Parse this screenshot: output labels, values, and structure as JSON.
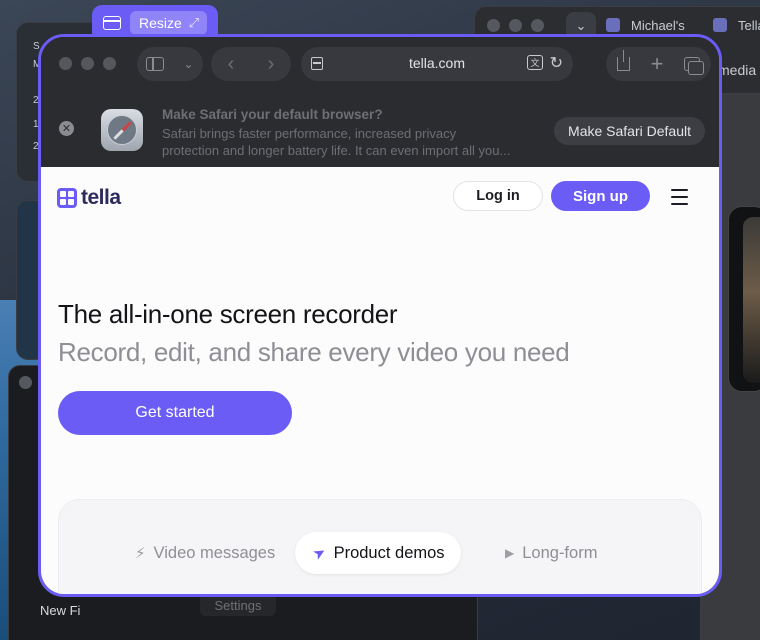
{
  "desktop": {
    "bg_tab_1": "Michael's",
    "bg_tab_2": "Tella",
    "bg_media": "media",
    "bg_settings": "Settings",
    "bg_new_label": "New Fi",
    "bg_side_chars": [
      "S",
      "M",
      "2",
      "1",
      "2"
    ]
  },
  "resize_tab": {
    "label": "Resize"
  },
  "browser": {
    "url": "tella.com",
    "banner": {
      "title": "Make Safari your default browser?",
      "body_line1": "Safari brings faster performance, increased privacy",
      "body_line2": "protection and longer battery life. It can even import all you...",
      "button": "Make Safari Default"
    }
  },
  "page": {
    "logo_text": "tella",
    "login": "Log in",
    "signup": "Sign up",
    "hero_title": "The all-in-one screen recorder",
    "hero_subtitle": "Record, edit, and share every video you need",
    "cta": "Get started",
    "tabs": [
      {
        "label": "Video messages",
        "icon": "bolt-icon"
      },
      {
        "label": "Product demos",
        "icon": "cursor-icon",
        "active": true
      },
      {
        "label": "Long-form",
        "icon": "play-icon"
      }
    ]
  },
  "colors": {
    "accent": "#6a5cf5",
    "toolbar": "#2b2c30",
    "page_bg": "#fcfcfd"
  }
}
